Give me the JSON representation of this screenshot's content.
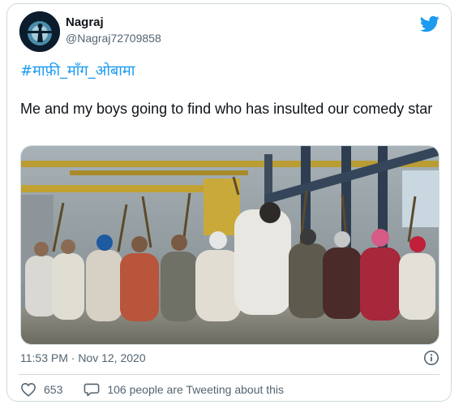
{
  "tweet": {
    "author_name": "Nagraj",
    "author_handle": "@Nagraj72709858",
    "hashtag": "#माफ़ी_माँग_ओबामा",
    "text": "Me and my boys going to find who has insulted our comedy star",
    "timestamp": "11:53 PM · Nov 12, 2020",
    "like_count": "653",
    "conversation_text": "106 people are Tweeting about this"
  },
  "icons": {
    "brand": "twitter-bird-icon",
    "info": "info-icon",
    "like": "heart-icon",
    "reply": "speech-bubble-icon"
  },
  "colors": {
    "accent": "#1d9bf0",
    "text": "#0f1419",
    "muted": "#536471",
    "border": "#cfd9de"
  }
}
